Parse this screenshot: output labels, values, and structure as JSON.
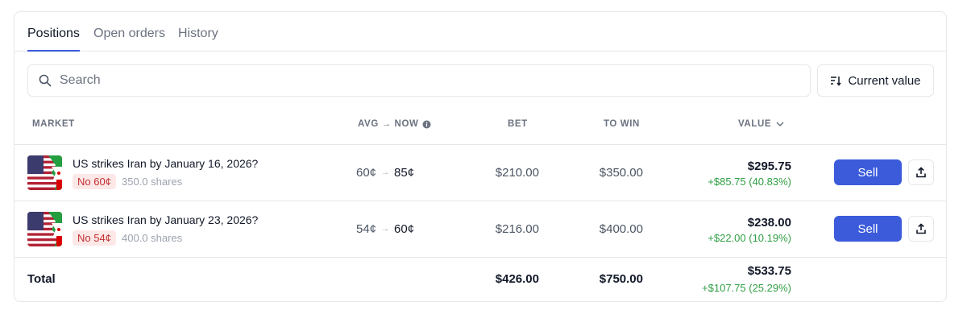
{
  "tabs": [
    {
      "label": "Positions",
      "active": true
    },
    {
      "label": "Open orders",
      "active": false
    },
    {
      "label": "History",
      "active": false
    }
  ],
  "search": {
    "placeholder": "Search"
  },
  "sort": {
    "label": "Current value"
  },
  "columns": {
    "market": "MARKET",
    "avg_now": "AVG → NOW",
    "bet": "BET",
    "to_win": "TO WIN",
    "value": "VALUE"
  },
  "rows": [
    {
      "title": "US strikes Iran by January 16, 2026?",
      "side": "No 60¢",
      "shares": "350.0 shares",
      "avg": "60¢",
      "now": "85¢",
      "bet": "$210.00",
      "to_win": "$350.00",
      "value": "$295.75",
      "pnl": "+$85.75 (40.83%)",
      "sell": "Sell"
    },
    {
      "title": "US strikes Iran by January 23, 2026?",
      "side": "No 54¢",
      "shares": "400.0 shares",
      "avg": "54¢",
      "now": "60¢",
      "bet": "$216.00",
      "to_win": "$400.00",
      "value": "$238.00",
      "pnl": "+$22.00 (10.19%)",
      "sell": "Sell"
    }
  ],
  "total": {
    "label": "Total",
    "bet": "$426.00",
    "to_win": "$750.00",
    "value": "$533.75",
    "pnl": "+$107.75 (25.29%)"
  },
  "colors": {
    "accent": "#3b5bdb",
    "positive": "#2f9e44",
    "badge_bg": "#fde8e8",
    "badge_text": "#c53030"
  }
}
